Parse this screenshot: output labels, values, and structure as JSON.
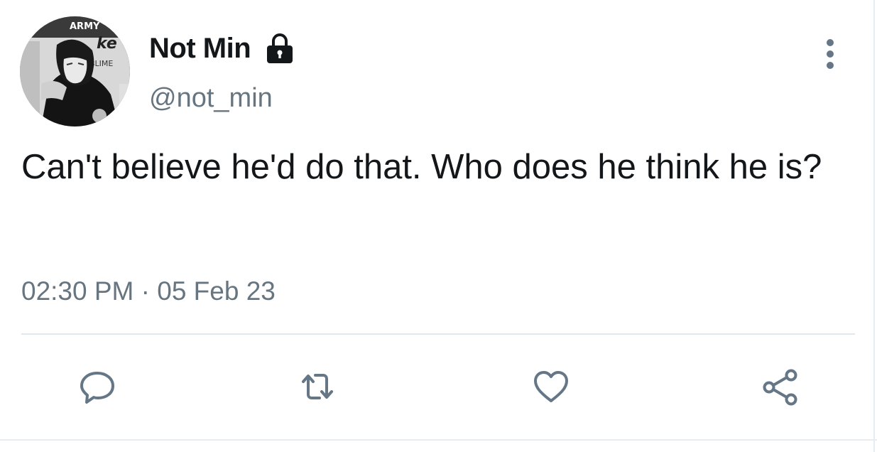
{
  "tweet": {
    "display_name": "Not Min",
    "handle": "@not_min",
    "text": "Can't believe he'd do that. Who does he think he is?",
    "timestamp": "02:30 PM · 05 Feb 23",
    "protected": true
  },
  "avatar": {
    "text_army": "ARMY",
    "text_ke": "ke",
    "text_blime": "BLIME"
  },
  "icons": {
    "lock": "lock-icon",
    "more": "more-vertical-icon",
    "reply": "reply-icon",
    "retweet": "retweet-icon",
    "like": "heart-icon",
    "share": "share-icon"
  },
  "colors": {
    "text_primary": "#14171a",
    "text_secondary": "#66757f",
    "icon_color": "#657786",
    "divider": "#e1e8ed"
  }
}
